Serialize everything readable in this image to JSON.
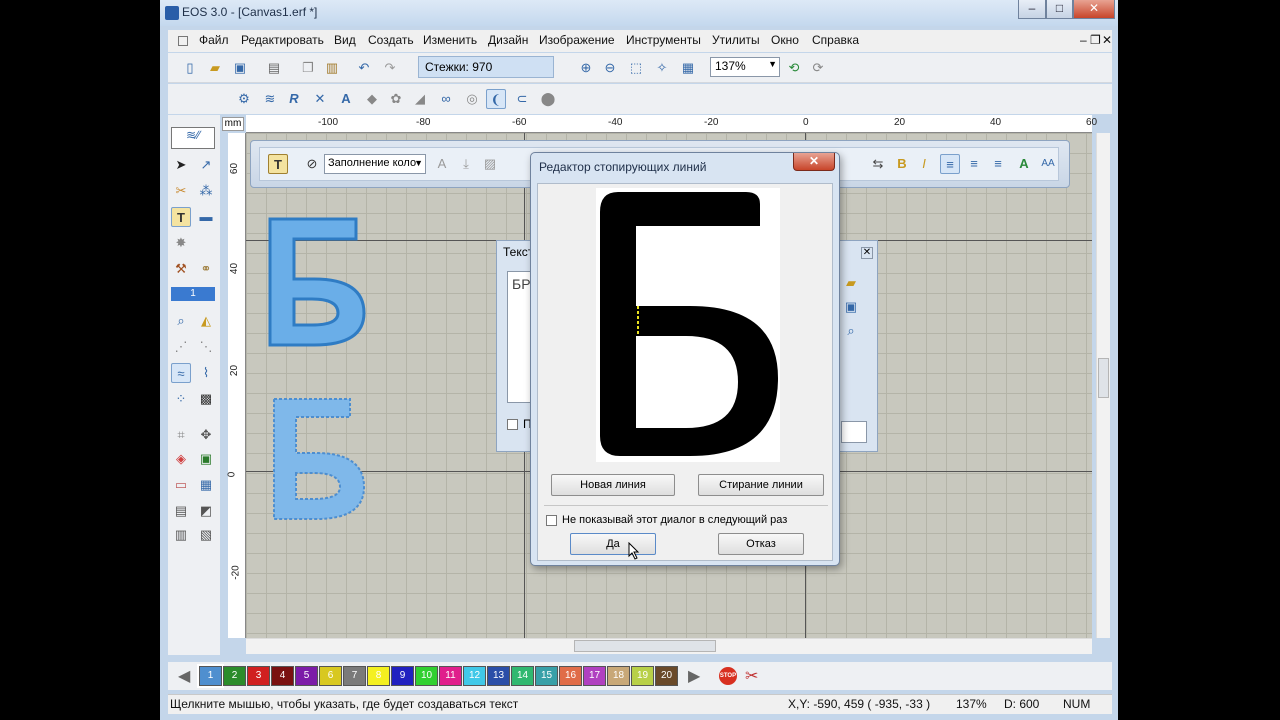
{
  "window": {
    "title": "EOS 3.0 - [Canvas1.erf *]",
    "min": "–",
    "max": "□",
    "close": "✕"
  },
  "menu": [
    "Файл",
    "Редактировать",
    "Вид",
    "Создать",
    "Изменить",
    "Дизайн",
    "Изображение",
    "Инструменты",
    "Утилиты",
    "Окно",
    "Справка"
  ],
  "mdi": {
    "min": "–",
    "restore": "❐",
    "close": "✕"
  },
  "toolbar": {
    "stitches": "Стежки: 970",
    "zoom": "137%"
  },
  "ruler": {
    "unit": "mm",
    "h": [
      "-100",
      "-80",
      "-60",
      "-40",
      "-20",
      "0",
      "20",
      "40",
      "60"
    ],
    "v": [
      "60",
      "40",
      "20",
      "0",
      "-20"
    ]
  },
  "texttoolbar": {
    "fill": "Заполнение коло"
  },
  "textdialog": {
    "title": "Текст",
    "value": "БР",
    "check": "П"
  },
  "dialog": {
    "title": "Редактор стопирующих линий",
    "close": "✕",
    "new_line": "Новая линия",
    "erase_line": "Стирание линии",
    "dont_show": "Не показывай этот диалог в следующий раз",
    "ok": "Да",
    "cancel": "Отказ",
    "letter": "Б"
  },
  "palette": {
    "numbers": [
      "1",
      "2",
      "3",
      "4",
      "5",
      "6",
      "7",
      "8",
      "9",
      "10",
      "11",
      "12",
      "13",
      "14",
      "15",
      "16",
      "17",
      "18",
      "19",
      "20"
    ],
    "colors": [
      "#4f8fcf",
      "#2b8c2b",
      "#d02020",
      "#7a1010",
      "#7c1ca8",
      "#d8c820",
      "#7a7a7a",
      "#f4f020",
      "#2020c0",
      "#30d030",
      "#e01e8c",
      "#40c8e8",
      "#2a4ea8",
      "#30b870",
      "#38a0a8",
      "#e06c48",
      "#b040c0",
      "#c8a878",
      "#b8d048",
      "#6a4a2a"
    ],
    "stop": "STOP"
  },
  "status": {
    "message": "Щелкните мышью, чтобы указать, где будет создаваться текст",
    "coords": "X,Y: -590, 459  ( -935, -33 )",
    "zoom": "137%",
    "density": "D: 600",
    "num": "NUM"
  }
}
